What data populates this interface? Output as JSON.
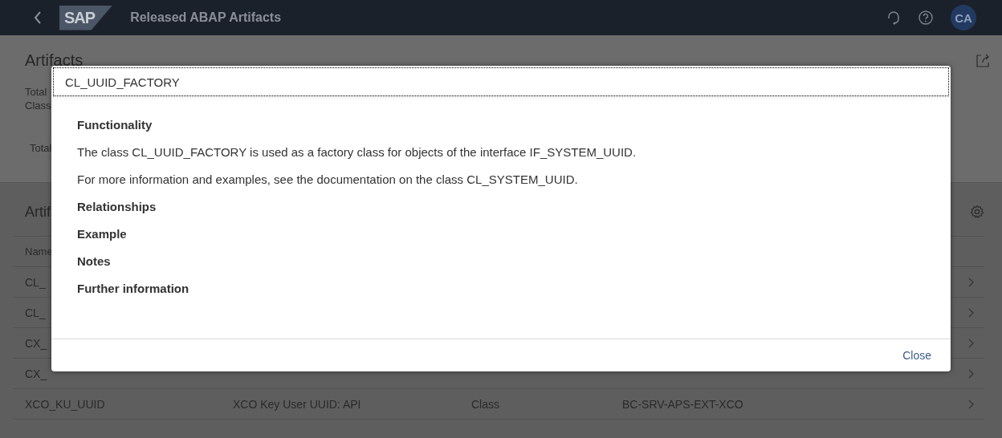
{
  "shell_bar": {
    "logo": "SAP",
    "title": "Released ABAP Artifacts",
    "avatar": "CA"
  },
  "header": {
    "title": "Artifacts",
    "fields": [
      "Total",
      "Class"
    ],
    "tab": "Total"
  },
  "table": {
    "title": "Artif",
    "columns": [
      "Name"
    ],
    "rows": [
      {
        "cells": [
          "CL_"
        ]
      },
      {
        "cells": [
          "CL_"
        ]
      },
      {
        "cells": [
          "CX_"
        ]
      },
      {
        "cells": [
          "CX_"
        ]
      },
      {
        "cells": [
          "XCO_KU_UUID",
          "XCO Key User UUID: API",
          "Class",
          "BC-SRV-APS-EXT-XCO"
        ]
      }
    ]
  },
  "dialog": {
    "title": "CL_UUID_FACTORY",
    "content": [
      {
        "kind": "heading",
        "text": "Functionality"
      },
      {
        "kind": "paragraph",
        "text": "The class CL_UUID_FACTORY is used as a factory class for objects of the interface IF_SYSTEM_UUID."
      },
      {
        "kind": "paragraph",
        "text": "For more information and examples, see the documentation on the class CL_SYSTEM_UUID."
      },
      {
        "kind": "heading",
        "text": "Relationships"
      },
      {
        "kind": "heading",
        "text": "Example"
      },
      {
        "kind": "heading",
        "text": "Notes"
      },
      {
        "kind": "heading",
        "text": "Further information"
      }
    ],
    "close": "Close"
  }
}
